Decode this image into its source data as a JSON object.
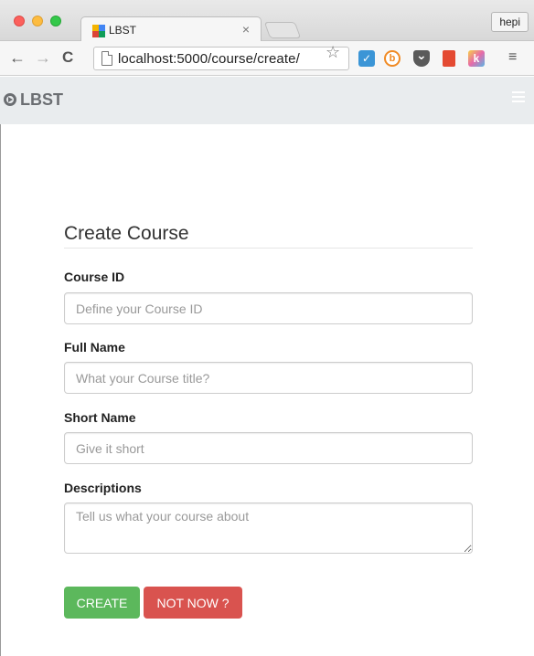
{
  "browser": {
    "tab_title": "LBST",
    "tab_close": "×",
    "profile_name": "hepi",
    "back_icon": "←",
    "forward_icon": "→",
    "reload_icon": "C",
    "url": "localhost:5000/course/create/",
    "bookmark_icon": "☆",
    "menu_icon": "≡",
    "extensions": [
      "check-extension-icon",
      "b-extension-icon",
      "pocket-icon",
      "book-extension-icon",
      "k-extension-icon"
    ]
  },
  "navbar": {
    "brand": "LBST",
    "background": "#e9ecee"
  },
  "form": {
    "title": "Create Course",
    "fields": [
      {
        "label": "Course ID",
        "placeholder": "Define your Course ID",
        "value": ""
      },
      {
        "label": "Full Name",
        "placeholder": "What your Course title?",
        "value": ""
      },
      {
        "label": "Short Name",
        "placeholder": "Give it short",
        "value": ""
      },
      {
        "label": "Descriptions",
        "placeholder": "Tell us what your course about",
        "value": ""
      }
    ],
    "buttons": {
      "create": "CREATE",
      "cancel": "NOT NOW ?"
    },
    "colors": {
      "create": "#5cb85c",
      "cancel": "#d9534f"
    }
  }
}
